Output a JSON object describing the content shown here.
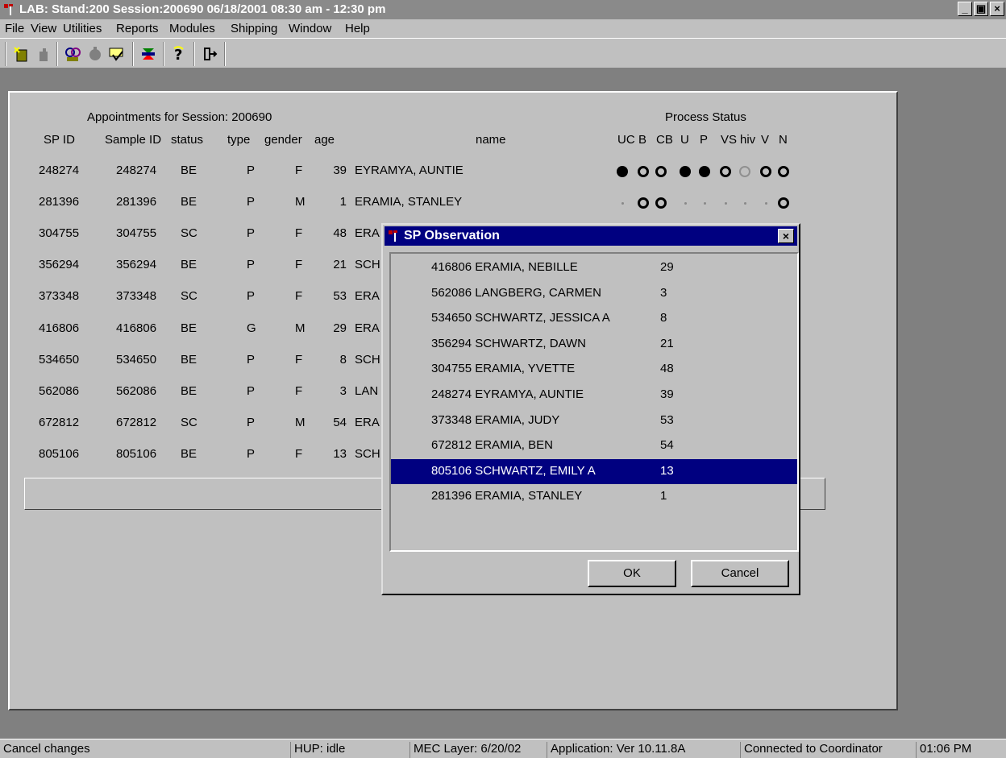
{
  "window": {
    "title": "LAB: Stand:200 Session:200690 06/18/2001 08:30 am - 12:30 pm",
    "min_label": "_",
    "max_label": "▣",
    "close_label": "×"
  },
  "menu": [
    "File",
    "View",
    "Utilities",
    "Reports",
    "Modules",
    "Shipping",
    "Window",
    "Help"
  ],
  "toolbar": {
    "icons": [
      "new-icon",
      "open-icon",
      "find-icon",
      "record-icon",
      "check-icon",
      "process-icon",
      "help-icon",
      "exit-icon"
    ]
  },
  "appointments": {
    "heading": "Appointments for Session: 200690",
    "process_heading": "Process Status",
    "columns": {
      "sp_id": "SP ID",
      "sample_id": "Sample ID",
      "status": "status",
      "type": "type",
      "gender": "gender",
      "age": "age",
      "name": "name",
      "process": [
        "UC",
        "B",
        "CB",
        "U",
        "P",
        "VS",
        "hiv",
        "V",
        "N"
      ]
    },
    "rows": [
      {
        "sp_id": "248274",
        "sample_id": "248274",
        "status": "BE",
        "type": "P",
        "gender": "F",
        "age": "39",
        "name": "EYRAMYA, AUNTIE",
        "process": [
          "full",
          "open",
          "open",
          "full",
          "full",
          "open",
          "grey",
          "open",
          "open"
        ]
      },
      {
        "sp_id": "281396",
        "sample_id": "281396",
        "status": "BE",
        "type": "P",
        "gender": "M",
        "age": "1",
        "name": "ERAMIA, STANLEY",
        "process": [
          "small",
          "open",
          "open",
          "small",
          "small",
          "small",
          "small",
          "small",
          "open"
        ]
      },
      {
        "sp_id": "304755",
        "sample_id": "304755",
        "status": "SC",
        "type": "P",
        "gender": "F",
        "age": "48",
        "name": "ERA",
        "process": [
          "",
          "",
          "",
          "",
          "",
          "",
          "",
          "",
          "grey"
        ]
      },
      {
        "sp_id": "356294",
        "sample_id": "356294",
        "status": "BE",
        "type": "P",
        "gender": "F",
        "age": "21",
        "name": "SCH",
        "process": [
          "",
          "",
          "",
          "",
          "",
          "",
          "",
          "",
          "grey"
        ]
      },
      {
        "sp_id": "373348",
        "sample_id": "373348",
        "status": "SC",
        "type": "P",
        "gender": "F",
        "age": "53",
        "name": "ERA",
        "process": [
          "",
          "",
          "",
          "",
          "",
          "",
          "",
          "",
          "grey"
        ]
      },
      {
        "sp_id": "416806",
        "sample_id": "416806",
        "status": "BE",
        "type": "G",
        "gender": "M",
        "age": "29",
        "name": "ERA",
        "process": [
          "",
          "",
          "",
          "",
          "",
          "",
          "",
          "",
          "small"
        ]
      },
      {
        "sp_id": "534650",
        "sample_id": "534650",
        "status": "BE",
        "type": "P",
        "gender": "F",
        "age": "8",
        "name": "SCH",
        "process": [
          "",
          "",
          "",
          "",
          "",
          "",
          "",
          "",
          "open"
        ]
      },
      {
        "sp_id": "562086",
        "sample_id": "562086",
        "status": "BE",
        "type": "P",
        "gender": "F",
        "age": "3",
        "name": "LAN",
        "process": [
          "",
          "",
          "",
          "",
          "",
          "",
          "",
          "",
          "open"
        ]
      },
      {
        "sp_id": "672812",
        "sample_id": "672812",
        "status": "SC",
        "type": "P",
        "gender": "M",
        "age": "54",
        "name": "ERA",
        "process": [
          "",
          "",
          "",
          "",
          "",
          "",
          "",
          "",
          "grey"
        ]
      },
      {
        "sp_id": "805106",
        "sample_id": "805106",
        "status": "BE",
        "type": "P",
        "gender": "F",
        "age": "13",
        "name": "SCH",
        "process": [
          "",
          "",
          "",
          "",
          "",
          "",
          "",
          "",
          "grey"
        ]
      }
    ]
  },
  "dialog": {
    "title": "SP Observation",
    "close_label": "×",
    "items": [
      {
        "id_name": "416806 ERAMIA, NEBILLE",
        "age": "29"
      },
      {
        "id_name": "562086 LANGBERG, CARMEN",
        "age": "3"
      },
      {
        "id_name": "534650 SCHWARTZ, JESSICA A",
        "age": "8"
      },
      {
        "id_name": "356294 SCHWARTZ, DAWN",
        "age": "21"
      },
      {
        "id_name": "304755 ERAMIA, YVETTE",
        "age": "48"
      },
      {
        "id_name": "248274 EYRAMYA, AUNTIE",
        "age": "39"
      },
      {
        "id_name": "373348 ERAMIA, JUDY",
        "age": "53"
      },
      {
        "id_name": "672812 ERAMIA, BEN",
        "age": "54"
      },
      {
        "id_name": "805106 SCHWARTZ, EMILY A",
        "age": "13"
      },
      {
        "id_name": "281396 ERAMIA, STANLEY",
        "age": "1"
      }
    ],
    "selected_index": 8,
    "ok_label": "OK",
    "cancel_label": "Cancel"
  },
  "statusbar": {
    "message": "Cancel changes",
    "hup": "HUP: idle",
    "mec_layer": "MEC Layer: 6/20/02",
    "application": "Application: Ver 10.11.8A",
    "connection": "Connected to Coordinator",
    "time": "01:06 PM"
  }
}
